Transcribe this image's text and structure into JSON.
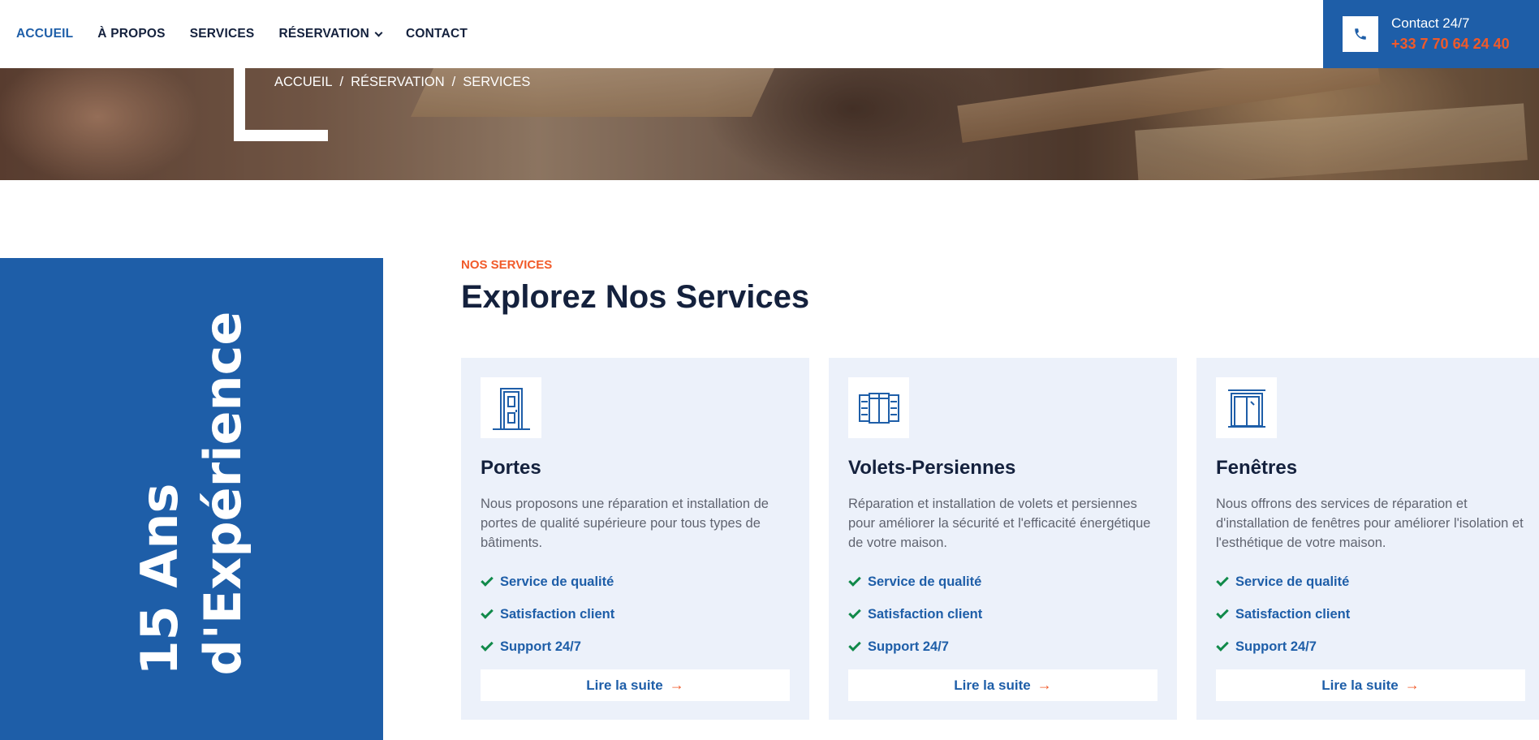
{
  "nav": {
    "items": [
      {
        "label": "ACCUEIL",
        "active": true
      },
      {
        "label": "À PROPOS"
      },
      {
        "label": "SERVICES"
      },
      {
        "label": "RÉSERVATION",
        "dropdown": true
      },
      {
        "label": "CONTACT"
      }
    ]
  },
  "contact": {
    "label": "Contact 24/7",
    "phone": "+33 7 70 64 24 40",
    "icon": "phone-icon"
  },
  "breadcrumb": {
    "items": [
      "ACCUEIL",
      "RÉSERVATION",
      "SERVICES"
    ],
    "separator": "/"
  },
  "experience": {
    "line1": "15 Ans",
    "line2": "d'Expérience"
  },
  "section": {
    "kicker": "NOS SERVICES",
    "title": "Explorez Nos Services"
  },
  "cards": [
    {
      "icon": "door-icon",
      "title": "Portes",
      "description": "Nous proposons une réparation et installation de portes de qualité supérieure pour tous types de bâtiments.",
      "features": [
        "Service de qualité",
        "Satisfaction client",
        "Support 24/7"
      ],
      "cta": "Lire la suite"
    },
    {
      "icon": "shutters-icon",
      "title": "Volets-Persiennes",
      "description": "Réparation et installation de volets et persiennes pour améliorer la sécurité et l'efficacité énergétique de votre maison.",
      "features": [
        "Service de qualité",
        "Satisfaction client",
        "Support 24/7"
      ],
      "cta": "Lire la suite"
    },
    {
      "icon": "window-icon",
      "title": "Fenêtres",
      "description": "Nous offrons des services de réparation et d'installation de fenêtres pour améliorer l'isolation et l'esthétique de votre maison.",
      "features": [
        "Service de qualité",
        "Satisfaction client",
        "Support 24/7"
      ],
      "cta": "Lire la suite"
    }
  ],
  "colors": {
    "primary": "#1e5ea8",
    "accent": "#f15a29",
    "dark": "#14213d",
    "card_bg": "#ecf1fa",
    "check": "#118a4a"
  }
}
